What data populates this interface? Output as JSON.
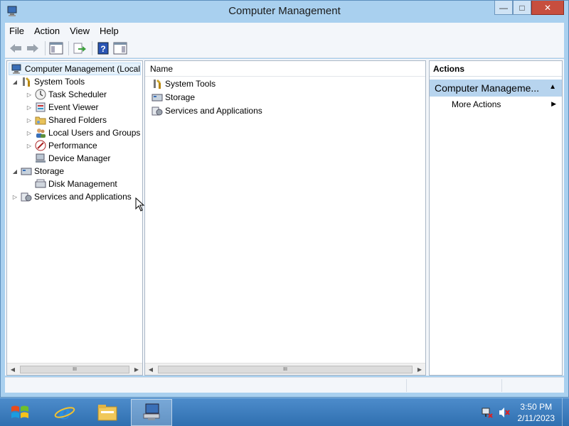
{
  "window": {
    "title": "Computer Management"
  },
  "menu": [
    "File",
    "Action",
    "View",
    "Help"
  ],
  "tree": {
    "root": "Computer Management (Local",
    "system_tools": "System Tools",
    "task_scheduler": "Task Scheduler",
    "event_viewer": "Event Viewer",
    "shared_folders": "Shared Folders",
    "local_users": "Local Users and Groups",
    "performance": "Performance",
    "device_manager": "Device Manager",
    "storage": "Storage",
    "disk_management": "Disk Management",
    "services_apps": "Services and Applications"
  },
  "list": {
    "column_name": "Name",
    "items": [
      "System Tools",
      "Storage",
      "Services and Applications"
    ]
  },
  "actions": {
    "header": "Actions",
    "section": "Computer Manageme...",
    "more_actions": "More Actions"
  },
  "scroll_label": "III",
  "taskbar": {
    "time": "3:50 PM",
    "date": "2/11/2023"
  },
  "colors": {
    "accent": "#a9d0ef",
    "taskbar": "#2f6fb0",
    "actions_section": "#b7d4ee",
    "close_button": "#c74e3e"
  },
  "icons": [
    "computer-management-icon",
    "back-icon",
    "forward-icon",
    "show-hide-tree-icon",
    "export-icon",
    "help-icon",
    "action-pane-icon",
    "system-tools-icon",
    "task-scheduler-icon",
    "event-viewer-icon",
    "shared-folders-icon",
    "local-users-icon",
    "performance-icon",
    "device-manager-icon",
    "storage-icon",
    "disk-management-icon",
    "services-icon",
    "windows-start-icon",
    "ie-icon",
    "file-explorer-icon",
    "network-icon",
    "speaker-muted-icon"
  ]
}
